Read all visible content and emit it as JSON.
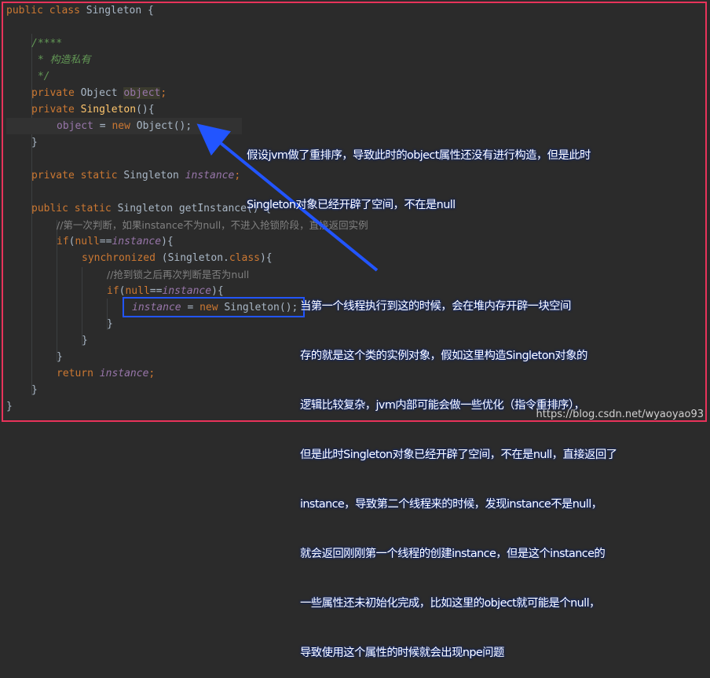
{
  "code": {
    "l1_kw": "public class ",
    "l1_name": "Singleton {",
    "l3": "/****",
    "l4": " * 构造私有",
    "l5": " */",
    "l6_kw": "private ",
    "l6_type": "Object ",
    "l6_field": "object",
    "l6_semi": ";",
    "l7_kw": "private ",
    "l7_name": "Singleton",
    "l7_rest": "(){",
    "l8_field": "object",
    "l8_eq": " = ",
    "l8_new": "new ",
    "l8_rest": "Object();",
    "l9": "}",
    "l11_kw": "private static ",
    "l11_type": "Singleton ",
    "l11_field": "instance",
    "l11_semi": ";",
    "l13_kw": "public static ",
    "l13_type": "Singleton ",
    "l13_method": "getInstance",
    "l13_rest": "() {",
    "l14": "//第一次判断，如果instance不为null，不进入抢锁阶段，直接返回实例",
    "l15_kw": "if",
    "l15_open": "(",
    "l15_null": "null",
    "l15_eq": "==",
    "l15_field": "instance",
    "l15_close": "){",
    "l16_kw": "synchronized ",
    "l16_rest1": "(Singleton.",
    "l16_class": "class",
    "l16_rest2": "){",
    "l17": "//抢到锁之后再次判断是否为null",
    "l18_kw": "if",
    "l18_open": "(",
    "l18_null": "null",
    "l18_eq": "==",
    "l18_field": "instance",
    "l18_close": "){",
    "l19_field": "instance",
    "l19_eq": " = ",
    "l19_new": "new ",
    "l19_rest": "Singleton();",
    "l20": "}",
    "l21": "}",
    "l22": "}",
    "l23_kw": "return ",
    "l23_field": "instance",
    "l23_semi": ";",
    "l24": "}",
    "l25": "}"
  },
  "annotations": {
    "a1_line1": "假设jvm做了重排序，导致此时的object属性还没有进行构造，但是此时",
    "a1_line2": "Singleton对象已经开辟了空间，不在是null",
    "a2_line1": "当第一个线程执行到这的时候，会在堆内存开辟一块空间",
    "a2_line2": "存的就是这个类的实例对象，假如这里构造Singleton对象的",
    "a2_line3": "逻辑比较复杂，jvm内部可能会做一些优化（指令重排序），",
    "a2_line4": "但是此时Singleton对象已经开辟了空间，不在是null，直接返回了",
    "a2_line5": "instance，导致第二个线程来的时候，发现instance不是null，",
    "a2_line6": "就会返回刚刚第一个线程的创建instance，但是这个instance的",
    "a2_line7": "一些属性还未初始化完成，比如这里的object就可能是个null，",
    "a2_line8": "导致使用这个属性的时候就会出现npe问题"
  },
  "watermark": "https://blog.csdn.net/wyaoyao93",
  "colors": {
    "frame": "#e8335a",
    "arrow": "#2255ff",
    "annotation_text": "#ffffff"
  }
}
